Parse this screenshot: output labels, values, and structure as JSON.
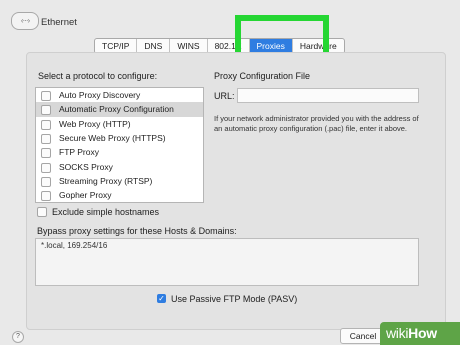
{
  "window": {
    "nav_icon": "back-forward-icon",
    "nav_glyph": "‹···›",
    "title": "Ethernet"
  },
  "tabs": [
    {
      "label": "TCP/IP",
      "active": false
    },
    {
      "label": "DNS",
      "active": false
    },
    {
      "label": "WINS",
      "active": false
    },
    {
      "label": "802.1X",
      "active": false
    },
    {
      "label": "Proxies",
      "active": true
    },
    {
      "label": "Hardware",
      "active": false
    }
  ],
  "protocols": {
    "heading": "Select a protocol to configure:",
    "items": [
      {
        "label": "Auto Proxy Discovery",
        "checked": false,
        "selected": false
      },
      {
        "label": "Automatic Proxy Configuration",
        "checked": false,
        "selected": true
      },
      {
        "label": "Web Proxy (HTTP)",
        "checked": false,
        "selected": false
      },
      {
        "label": "Secure Web Proxy (HTTPS)",
        "checked": false,
        "selected": false
      },
      {
        "label": "FTP Proxy",
        "checked": false,
        "selected": false
      },
      {
        "label": "SOCKS Proxy",
        "checked": false,
        "selected": false
      },
      {
        "label": "Streaming Proxy (RTSP)",
        "checked": false,
        "selected": false
      },
      {
        "label": "Gopher Proxy",
        "checked": false,
        "selected": false
      }
    ]
  },
  "proxy_config": {
    "heading": "Proxy Configuration File",
    "url_label": "URL:",
    "url_value": "",
    "note": "If your network administrator provided you with the address of an automatic proxy configuration (.pac) file, enter it above."
  },
  "exclude_simple": {
    "label": "Exclude simple hostnames",
    "checked": false
  },
  "bypass": {
    "label": "Bypass proxy settings for these Hosts & Domains:",
    "value": "*.local, 169.254/16"
  },
  "passive_ftp": {
    "label": "Use Passive FTP Mode (PASV)",
    "checked": true,
    "check_glyph": "✓"
  },
  "footer": {
    "help_glyph": "?",
    "cancel_label": "Cancel"
  },
  "watermark": {
    "prefix": "wiki",
    "suffix": "How"
  },
  "colors": {
    "accent": "#2f7de1",
    "highlight": "#25d633",
    "watermark": "#5ea447"
  }
}
